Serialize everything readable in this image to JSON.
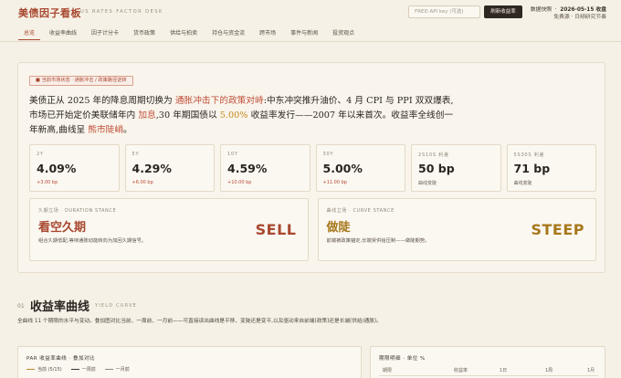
{
  "header": {
    "brand": "美债因子看板",
    "brand_sub": "US RATES FACTOR DESK",
    "api_placeholder": "FRED API key (可选)",
    "refresh_label": "刷新收益率",
    "snapshot_label": "数据快照",
    "snapshot_date": "2026-05-15 收盘",
    "snapshot_source": "免费源 · 日频研究节奏"
  },
  "nav": {
    "items": [
      "总览",
      "收益率曲线",
      "因子计分卡",
      "货币政策",
      "供给与拍卖",
      "持仓与资金流",
      "跨市场",
      "事件与新闻",
      "投资观点"
    ],
    "active_index": 0
  },
  "hero": {
    "alert": "当前市场状态 · 通胀冲击 / 政策路径逆转",
    "headline_parts": {
      "p1": "美债正从 2025 年的降息周期切换为 ",
      "p2": "通胀冲击下的政策对峙",
      "p3": ":中东冲突推升油价、4 月 CPI 与 PPI 双双爆表,市场已开始定价美联储年内 ",
      "p4": "加息",
      "p5": ",30 年期国债以 ",
      "p6": "5.00%",
      "p7": " 收益率发行——2007 年以来首次。收益率全线创一年新高,曲线呈 ",
      "p8": "熊市陡峭",
      "p9": "。"
    },
    "stats": [
      {
        "label": "2Y",
        "value": "4.09%",
        "sub": "+3.00 bp",
        "sub_style": "up"
      },
      {
        "label": "5Y",
        "value": "4.29%",
        "sub": "+6.00 bp",
        "sub_style": "up"
      },
      {
        "label": "10Y",
        "value": "4.59%",
        "sub": "+10.00 bp",
        "sub_style": "up"
      },
      {
        "label": "30Y",
        "value": "5.00%",
        "sub": "+11.00 bp",
        "sub_style": "up"
      },
      {
        "label": "2S10S 利差",
        "value": "50 bp",
        "sub": "曲线变陡",
        "sub_style": "neutral"
      },
      {
        "label": "5S30S 利差",
        "value": "71 bp",
        "sub": "曲线变陡",
        "sub_style": "neutral"
      }
    ],
    "stances": [
      {
        "label": "久期立场 · DURATION STANCE",
        "title": "看空久期",
        "desc": "组合久期低配,等待通胀动能转向为加回久期信号。",
        "action": "SELL",
        "tone": "red"
      },
      {
        "label": "曲线立场 · CURVE STANCE",
        "title": "做陡",
        "desc": "前端被政策锚定,长端受供给压制——做陡期势。",
        "action": "STEEP",
        "tone": "gold"
      }
    ]
  },
  "section": {
    "num": "01",
    "title": "收益率曲线",
    "en": "YIELD CURVE",
    "desc": "全曲线 11 个期限的水平与变动。叠加图对比当前、一周前、一月前——可直接读出曲线是平移、变陡还是变平,以及驱动来自前端(政策)还是长端(供给/通胀)。"
  },
  "chart_card": {
    "title": "PAR 收益率曲线 · 叠加对比",
    "legend": [
      {
        "label": "当前 (5/15)",
        "color": "#b8892a"
      },
      {
        "label": "一周前",
        "color": "#3a322b"
      },
      {
        "label": "一月前",
        "color": "#8f8677"
      }
    ]
  },
  "table_card": {
    "title": "期限明细 · 单位 %",
    "headers": [
      "期限",
      "收益率",
      "1日",
      "1周",
      "1月"
    ]
  },
  "colors": {
    "accent_red": "#a8482f",
    "accent_gold": "#a7781c",
    "background": "#f6f1e6"
  }
}
